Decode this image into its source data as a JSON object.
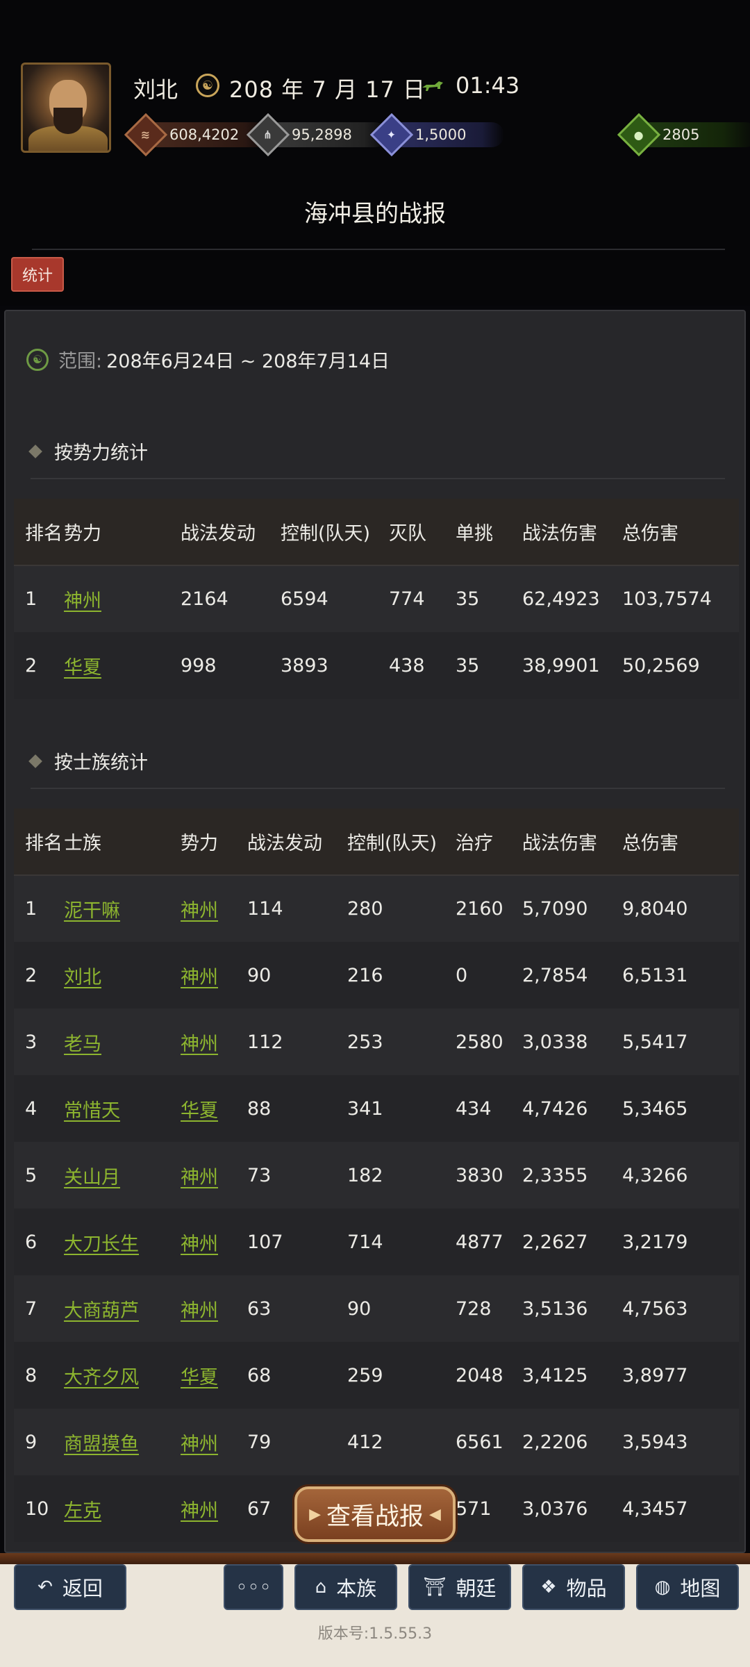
{
  "header": {
    "player_name": "刘北",
    "game_date": "208 年 7 月 17 日",
    "game_time": "01:43",
    "resources": [
      {
        "name": "copper-icon",
        "value": "608,4202"
      },
      {
        "name": "grain-icon",
        "value": "95,2898"
      },
      {
        "name": "troops-icon",
        "value": "1,5000"
      },
      {
        "name": "jade-icon",
        "value": "2805"
      }
    ]
  },
  "report": {
    "title": "海冲县的战报",
    "stats_tab": "统计",
    "range_label": "范围:",
    "range_value": "208年6月24日 ~ 208年7月14日"
  },
  "faction_section": {
    "title": "按势力统计",
    "headers": [
      "排名",
      "势力",
      "战法发动",
      "控制(队天)",
      "灭队",
      "单挑",
      "战法伤害",
      "总伤害"
    ],
    "rows": [
      [
        "1",
        "神州",
        "2164",
        "6594",
        "774",
        "35",
        "62,4923",
        "103,7574"
      ],
      [
        "2",
        "华夏",
        "998",
        "3893",
        "438",
        "35",
        "38,9901",
        "50,2569"
      ]
    ]
  },
  "clan_section": {
    "title": "按士族统计",
    "headers": [
      "排名",
      "士族",
      "势力",
      "战法发动",
      "控制(队天)",
      "治疗",
      "战法伤害",
      "总伤害"
    ],
    "rows": [
      [
        "1",
        "泥干嘛",
        "神州",
        "114",
        "280",
        "2160",
        "5,7090",
        "9,8040"
      ],
      [
        "2",
        "刘北",
        "神州",
        "90",
        "216",
        "0",
        "2,7854",
        "6,5131"
      ],
      [
        "3",
        "老马",
        "神州",
        "112",
        "253",
        "2580",
        "3,0338",
        "5,5417"
      ],
      [
        "4",
        "常惜天",
        "华夏",
        "88",
        "341",
        "434",
        "4,7426",
        "5,3465"
      ],
      [
        "5",
        "关山月",
        "神州",
        "73",
        "182",
        "3830",
        "2,3355",
        "4,3266"
      ],
      [
        "6",
        "大刀长生",
        "神州",
        "107",
        "714",
        "4877",
        "2,2627",
        "3,2179"
      ],
      [
        "7",
        "大商葫芦",
        "神州",
        "63",
        "90",
        "728",
        "3,5136",
        "4,7563"
      ],
      [
        "8",
        "大齐夕风",
        "华夏",
        "68",
        "259",
        "2048",
        "3,4125",
        "3,8977"
      ],
      [
        "9",
        "商盟摸鱼",
        "神州",
        "79",
        "412",
        "6561",
        "2,2206",
        "3,5943"
      ],
      [
        "10",
        "左克",
        "神州",
        "67",
        "",
        "571",
        "3,0376",
        "4,3457"
      ]
    ]
  },
  "floating_button": "查看战报",
  "bottom_nav": {
    "back": "返回",
    "more": "◦◦◦",
    "clan": "本族",
    "court": "朝廷",
    "items": "物品",
    "map": "地图"
  },
  "version": "版本号:1.5.55.3",
  "colors": {
    "link_green": "#8db52f",
    "tab_red": "#a8382c",
    "nav_button": "#253346",
    "panel_bg": "#27272a"
  }
}
